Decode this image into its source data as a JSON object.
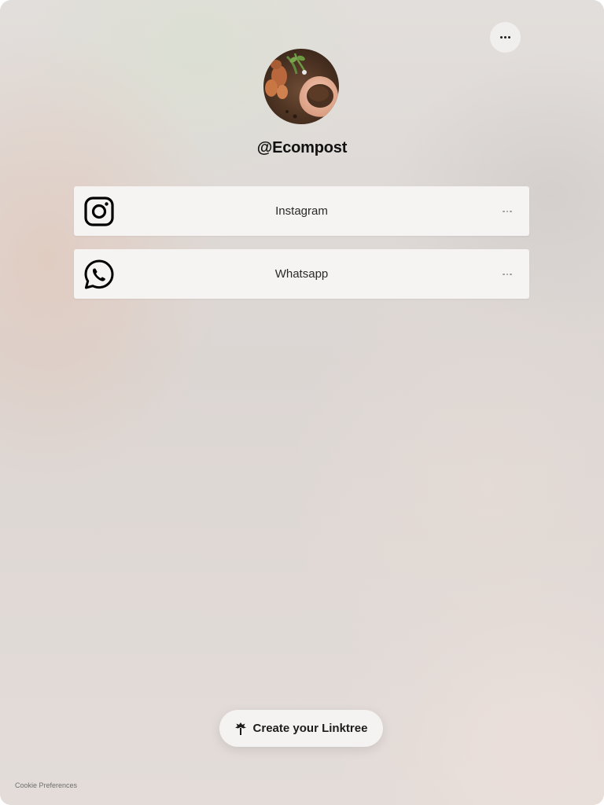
{
  "header": {
    "menu_icon": "more-horizontal-icon"
  },
  "profile": {
    "username": "@Ecompost",
    "avatar_icon": "compost-soil-photo"
  },
  "links": [
    {
      "label": "Instagram",
      "icon": "instagram-icon"
    },
    {
      "label": "Whatsapp",
      "icon": "whatsapp-icon"
    }
  ],
  "cta": {
    "label": "Create your Linktree",
    "icon": "linktree-logo-icon"
  },
  "footer": {
    "cookie_label": "Cookie Preferences"
  },
  "colors": {
    "card_background": "#f5f4f3",
    "text": "#111111",
    "icon_stroke": "#000000"
  }
}
